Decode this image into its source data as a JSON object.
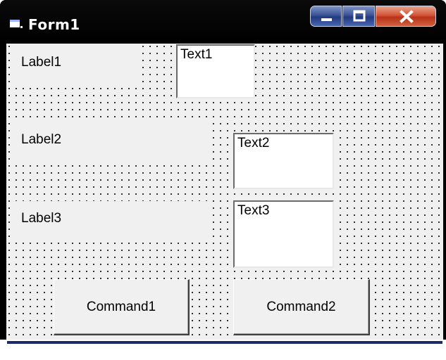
{
  "window": {
    "title": "Form1"
  },
  "icons": {
    "app": "form-icon",
    "minimize": "minimize-icon",
    "maximize": "maximize-icon",
    "close": "close-icon"
  },
  "labels": [
    "Label1",
    "Label2",
    "Label3"
  ],
  "textboxes": [
    "Text1",
    "Text2",
    "Text3"
  ],
  "buttons": [
    "Command1",
    "Command2"
  ],
  "colors": {
    "titlebar": "#000000",
    "form_bg": "#f0f0f0",
    "close_button": "#c8472a",
    "caption_buttons": "#3b5396"
  }
}
